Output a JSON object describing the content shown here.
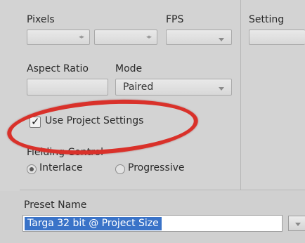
{
  "labels": {
    "pixels": "Pixels",
    "fps": "FPS",
    "setting": "Setting",
    "aspect_ratio": "Aspect Ratio",
    "mode": "Mode",
    "use_project_settings": "Use Project Settings",
    "fielding_control": "Fielding Control",
    "preset_name": "Preset Name"
  },
  "mode": {
    "selected": "Paired"
  },
  "use_project_settings_checked": true,
  "fielding": {
    "options": [
      "Interlace",
      "Progressive"
    ],
    "selected": "Interlace"
  },
  "preset": {
    "value": "Targa 32 bit @ Project Size"
  },
  "annotation": {
    "ring_color": "#d9312a"
  },
  "colors": {
    "selection": "#3a73c8"
  }
}
